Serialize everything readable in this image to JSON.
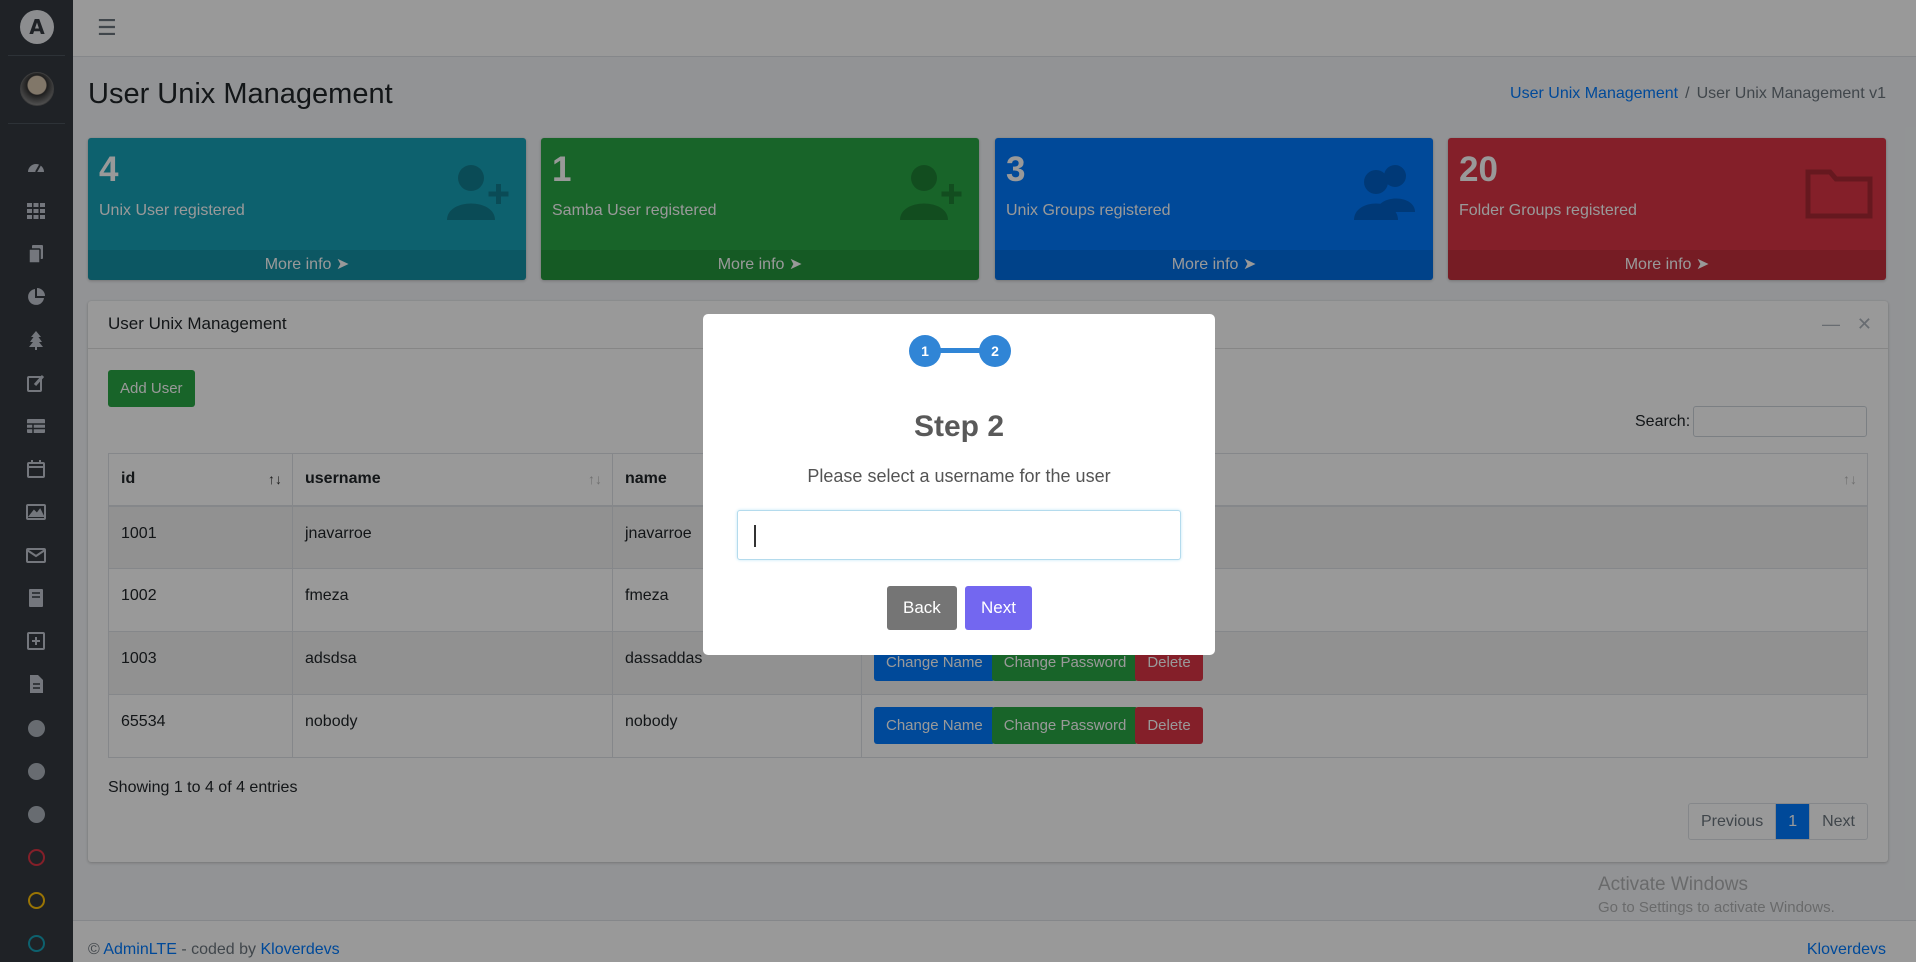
{
  "sidebar": {
    "brand_letter": "A",
    "icons": [
      "dashboard-icon",
      "apps-icon",
      "copy-icon",
      "pie-chart-icon",
      "tree-icon",
      "edit-icon",
      "table-icon",
      "calendar-icon",
      "image-icon",
      "envelope-icon",
      "book-icon",
      "plus-square-icon",
      "file-icon"
    ],
    "circle_colors": [
      "#adb5bd",
      "#adb5bd",
      "#adb5bd",
      "#dc3545",
      "#ffc107",
      "#17a2b8"
    ]
  },
  "header": {
    "title": "User Unix Management",
    "breadcrumb": [
      "User Unix Management",
      "User Unix Management v1"
    ]
  },
  "stats": [
    {
      "number": "4",
      "label": "Unix User registered",
      "more": "More info",
      "icon": "user-plus-icon",
      "color": "#17a2b8"
    },
    {
      "number": "1",
      "label": "Samba User registered",
      "more": "More info",
      "icon": "user-plus-icon",
      "color": "#28a745"
    },
    {
      "number": "3",
      "label": "Unix Groups registered",
      "more": "More info",
      "icon": "users-icon",
      "color": "#007bff"
    },
    {
      "number": "20",
      "label": "Folder Groups registered",
      "more": "More info",
      "icon": "folder-icon",
      "color": "#dc3545"
    }
  ],
  "card": {
    "title": "User Unix Management",
    "add_label": "Add User",
    "search_label": "Search:",
    "columns": [
      "id",
      "username",
      "name",
      ""
    ],
    "rows": [
      {
        "id": "1001",
        "username": "jnavarroe",
        "name": "jnavarroe",
        "actions": []
      },
      {
        "id": "1002",
        "username": "fmeza",
        "name": "fmeza",
        "actions": []
      },
      {
        "id": "1003",
        "username": "adsdsa",
        "name": "dassaddas",
        "actions": [
          "Change Name",
          "Change Password",
          "Delete"
        ]
      },
      {
        "id": "65534",
        "username": "nobody",
        "name": "nobody",
        "actions": [
          "Change Name",
          "Change Password",
          "Delete"
        ]
      }
    ],
    "showing": "Showing 1 to 4 of 4 entries",
    "pager": {
      "prev": "Previous",
      "page": "1",
      "next": "Next"
    }
  },
  "footer": {
    "copy": "©",
    "adminlte": "AdminLTE",
    "coded_by": "- coded by",
    "author": "Kloverdevs",
    "right": "Kloverdevs"
  },
  "watermark": {
    "title": "Activate Windows",
    "sub": "Go to Settings to activate Windows."
  },
  "modal": {
    "steps": [
      "1",
      "2"
    ],
    "title": "Step 2",
    "text": "Please select a username for the user",
    "input_value": "",
    "back_label": "Back",
    "next_label": "Next"
  }
}
